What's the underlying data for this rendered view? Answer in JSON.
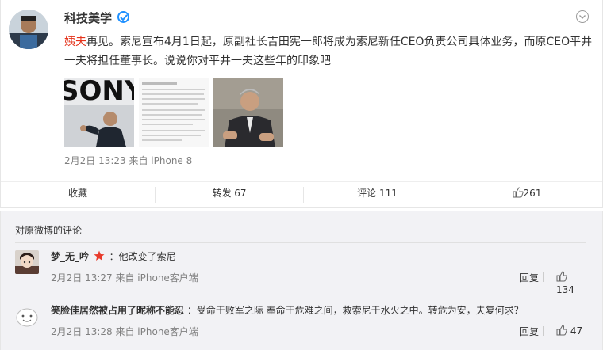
{
  "post": {
    "author": "科技美学",
    "mention": "姨夫",
    "text_rest": "再见。索尼宣布4月1日起，原副社长吉田宪一郎将成为索尼新任CEO负责公司具体业务，而原CEO平井一夫将担任董事长。说说你对平井一夫这些年的印象吧",
    "meta": "2月2日 13:23 来自 iPhone 8",
    "image_text": "SONY",
    "actions": {
      "favorite": "收藏",
      "repost": "转发 67",
      "comment": "评论 111",
      "like_count": "261"
    }
  },
  "comments": {
    "title": "对原微博的评论",
    "items": [
      {
        "name": "梦_无_吟",
        "text": "：他改变了索尼",
        "meta": "2月2日 13:27 来自 iPhone客户端",
        "reply": "回复",
        "likes": "134"
      },
      {
        "name": "笑脸佳居然被占用了昵称不能忍",
        "text": "：受命于败军之际 奉命于危难之间，救索尼于水火之中。转危为安，夫复何求？",
        "meta": "2月2日 13:28 来自 iPhone客户端",
        "reply": "回复",
        "likes": "47"
      }
    ]
  },
  "colors": {
    "mention": "#e5331b",
    "verified": "#1e90ff",
    "star": "#e83a2b"
  }
}
